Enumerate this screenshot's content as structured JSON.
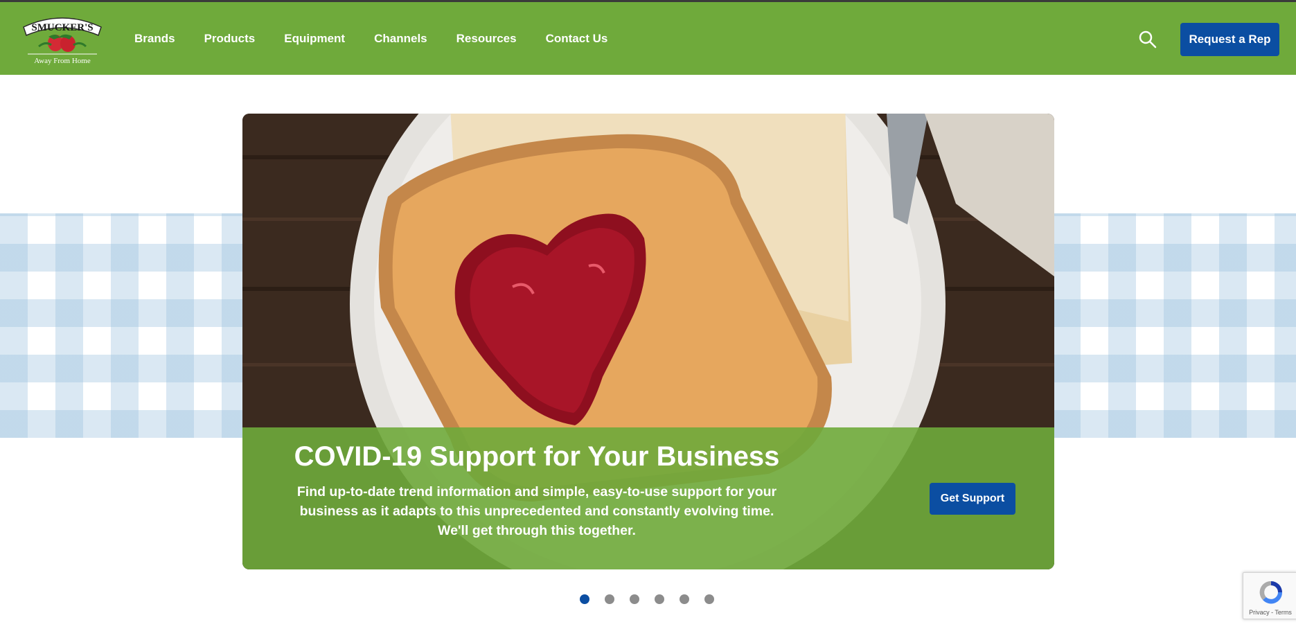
{
  "header": {
    "logo": {
      "brand": "SMUCKER'S",
      "tagline": "Away From Home"
    },
    "nav": [
      "Brands",
      "Products",
      "Equipment",
      "Channels",
      "Resources",
      "Contact Us"
    ],
    "search_icon": "search-icon",
    "request_rep_label": "Request a Rep"
  },
  "hero": {
    "title": "COVID-19 Support for Your Business",
    "body_lines": [
      "Find up-to-date trend information and simple, easy-to-use support for your",
      "business as it adapts to this unprecedented and constantly evolving time.",
      "We'll get through this together."
    ],
    "button_label": "Get Support"
  },
  "carousel": {
    "total_slides": 6,
    "active_slide": 1
  },
  "recaptcha": {
    "links": "Privacy - Terms"
  },
  "colors": {
    "header_green": "#6faa3b",
    "button_blue": "#0b4ea2",
    "dot_gray": "#8c8c8c",
    "gingham_blue": "#96bedc"
  }
}
